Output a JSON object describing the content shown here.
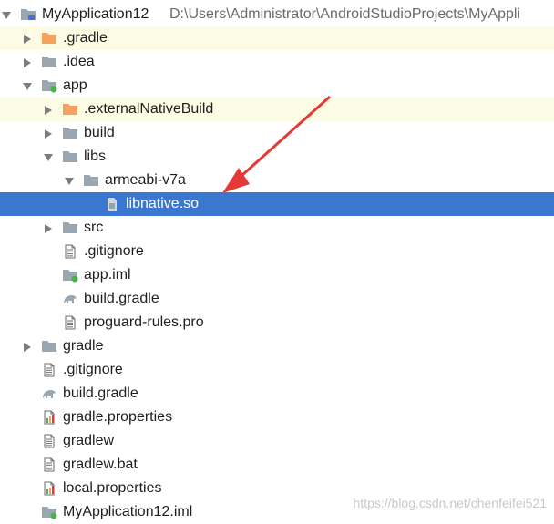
{
  "project": {
    "name": "MyApplication12",
    "path": "D:\\Users\\Administrator\\AndroidStudioProjects\\MyAppli"
  },
  "tree": [
    {
      "label": ".gradle",
      "icon": "folder-orange-icon",
      "expanded": false
    },
    {
      "label": ".idea",
      "icon": "folder-icon",
      "expanded": false
    },
    {
      "label": "app",
      "icon": "module-folder-icon",
      "expanded": true
    },
    {
      "label": ".externalNativeBuild",
      "icon": "folder-orange-icon",
      "expanded": false
    },
    {
      "label": "build",
      "icon": "folder-icon",
      "expanded": false
    },
    {
      "label": "libs",
      "icon": "folder-icon",
      "expanded": true
    },
    {
      "label": "armeabi-v7a",
      "icon": "folder-icon",
      "expanded": true
    },
    {
      "label": "libnative.so",
      "icon": "binary-file-icon",
      "selected": true
    },
    {
      "label": "src",
      "icon": "folder-icon",
      "expanded": false
    },
    {
      "label": ".gitignore",
      "icon": "text-file-icon"
    },
    {
      "label": "app.iml",
      "icon": "iml-file-icon"
    },
    {
      "label": "build.gradle",
      "icon": "gradle-elephant-icon"
    },
    {
      "label": "proguard-rules.pro",
      "icon": "text-file-icon"
    },
    {
      "label": "gradle",
      "icon": "folder-icon",
      "expanded": false
    },
    {
      "label": ".gitignore",
      "icon": "text-file-icon"
    },
    {
      "label": "build.gradle",
      "icon": "gradle-elephant-icon"
    },
    {
      "label": "gradle.properties",
      "icon": "properties-file-icon"
    },
    {
      "label": "gradlew",
      "icon": "text-file-icon"
    },
    {
      "label": "gradlew.bat",
      "icon": "text-file-icon"
    },
    {
      "label": "local.properties",
      "icon": "properties-file-icon"
    },
    {
      "label": "MyApplication12.iml",
      "icon": "iml-file-icon"
    }
  ],
  "watermark": "https://blog.csdn.net/chenfeifei521",
  "colors": {
    "selection": "#3b76cf",
    "highlight_row": "#fcfbe4",
    "folder": "#9aa7b0",
    "excluded_folder": "#f4a261",
    "annotation_arrow": "#e53935"
  }
}
